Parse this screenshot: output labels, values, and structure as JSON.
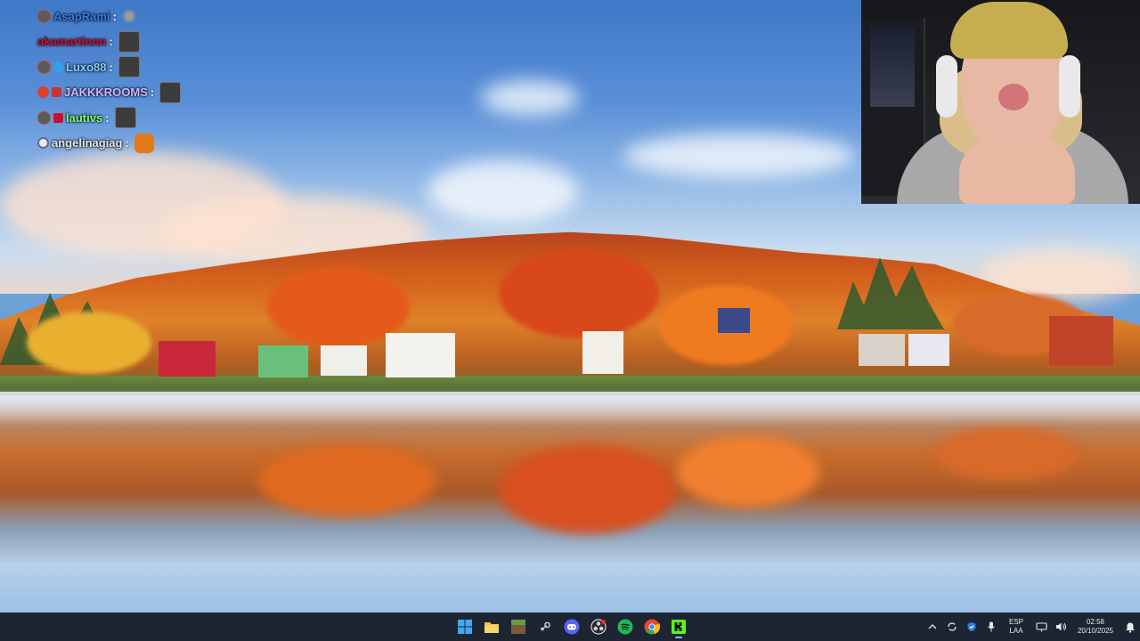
{
  "chat": {
    "messages": [
      {
        "user": "AsapRami",
        "sep": ":",
        "color": "#3b7be6",
        "badge_color": "#c04a2a",
        "emote": "smoke-emote",
        "emote_color": "#8a8a8a"
      },
      {
        "user": "akamartinnn",
        "sep": ":",
        "color": "#c8102e",
        "badge_color": "",
        "emote": "monkey-emote",
        "emote_color": "#444444"
      },
      {
        "user": "Luxo88",
        "sep": ":",
        "color": "#7fd4ff",
        "badge_color": "#c04a2a",
        "badge2_color": "#34a0e8",
        "emote": "monkey-emote",
        "emote_color": "#444444"
      },
      {
        "user": "JAKKKROOMS",
        "sep": ":",
        "color": "#d2b8ff",
        "badge_color": "#e0402a",
        "badge2_color": "#d0302a",
        "emote": "monkey-emote",
        "emote_color": "#444444"
      },
      {
        "user": "lautivs",
        "sep": ":",
        "color": "#7cfc6a",
        "badge_color": "#c04a2a",
        "badge2_color": "#c8102e",
        "emote": "monkey-emote",
        "emote_color": "#444444"
      },
      {
        "user": "angelinagiag",
        "sep": ":",
        "color": "#e8e8e8",
        "badge_color": "#8a8aaa",
        "emote": "pumpkin-emote",
        "emote_color": "#e07a1a"
      }
    ]
  },
  "taskbar": {
    "apps": [
      {
        "name": "start-button",
        "icon": "windows-icon",
        "color": "#3fa9f5"
      },
      {
        "name": "file-explorer-button",
        "icon": "folder-icon",
        "color": "#f2c14e"
      },
      {
        "name": "minecraft-button",
        "icon": "minecraft-icon",
        "color": "#6a9a3a"
      },
      {
        "name": "steam-button",
        "icon": "steam-icon",
        "color": "#c7d5e0"
      },
      {
        "name": "discord-button",
        "icon": "discord-icon",
        "color": "#5865f2"
      },
      {
        "name": "obs-button",
        "icon": "obs-icon",
        "color": "#d8d8d8"
      },
      {
        "name": "spotify-button",
        "icon": "spotify-icon",
        "color": "#1db954"
      },
      {
        "name": "chrome-button",
        "icon": "chrome-icon",
        "color": "#ea4335"
      },
      {
        "name": "kick-button",
        "icon": "kick-icon",
        "color": "#53fc18"
      }
    ],
    "tray": {
      "lang_top": "ESP",
      "lang_bottom": "LAA",
      "time": "02:58",
      "date": "20/10/2025"
    }
  }
}
